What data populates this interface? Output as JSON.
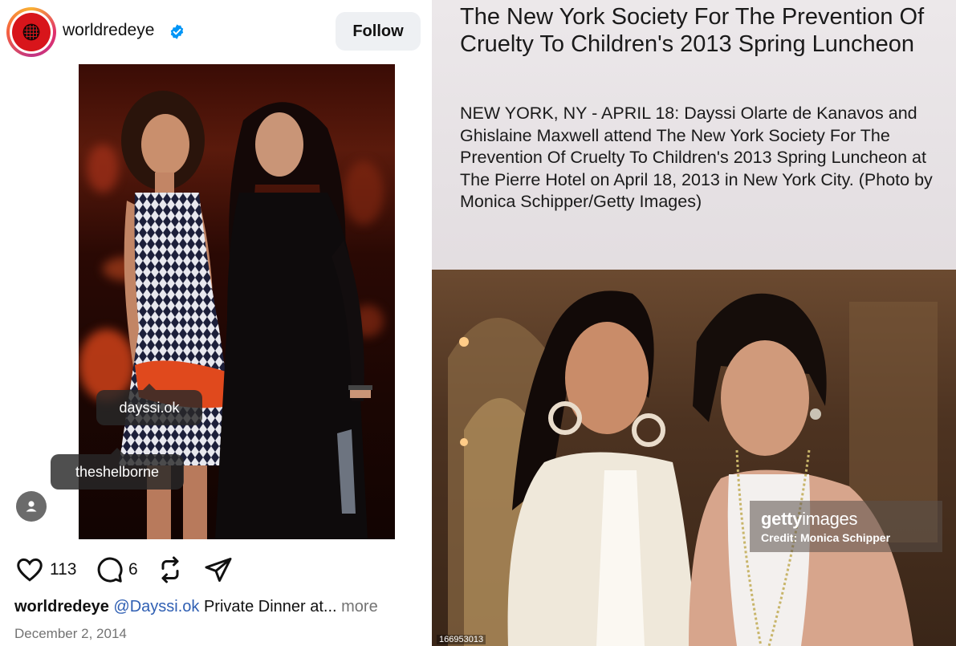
{
  "post": {
    "username": "worldredeye",
    "follow_label": "Follow",
    "tags": {
      "tag1": "dayssi.ok",
      "tag2": "theshelborne"
    },
    "likes_count": "113",
    "comments_count": "6",
    "caption": {
      "username": "worldredeye",
      "mention": "@Dayssi.ok",
      "text": " Private Dinner at...",
      "more": " more"
    },
    "date": "December 2, 2014"
  },
  "article": {
    "title": "The New York Society For The Prevention Of Cruelty To Children's 2013 Spring Luncheon",
    "caption": "NEW YORK, NY - APRIL 18: Dayssi Olarte de Kanavos and Ghislaine Maxwell attend The New York Society For The Prevention Of Cruelty To Children's 2013 Spring Luncheon at The Pierre Hotel on April 18, 2013 in New York City. (Photo by Monica Schipper/Getty Images)",
    "watermark": {
      "brand_bold": "getty",
      "brand_light": "images",
      "credit": "Credit: Monica Schipper"
    },
    "image_id": "166953013"
  },
  "icons": [
    "verified-badge-icon",
    "heart-icon",
    "comment-icon",
    "repost-icon",
    "share-icon",
    "person-tag-icon"
  ],
  "colors": {
    "verified_blue": "#0095f6",
    "mention_blue": "#2f5fb3",
    "follow_bg": "#eef0f3"
  }
}
